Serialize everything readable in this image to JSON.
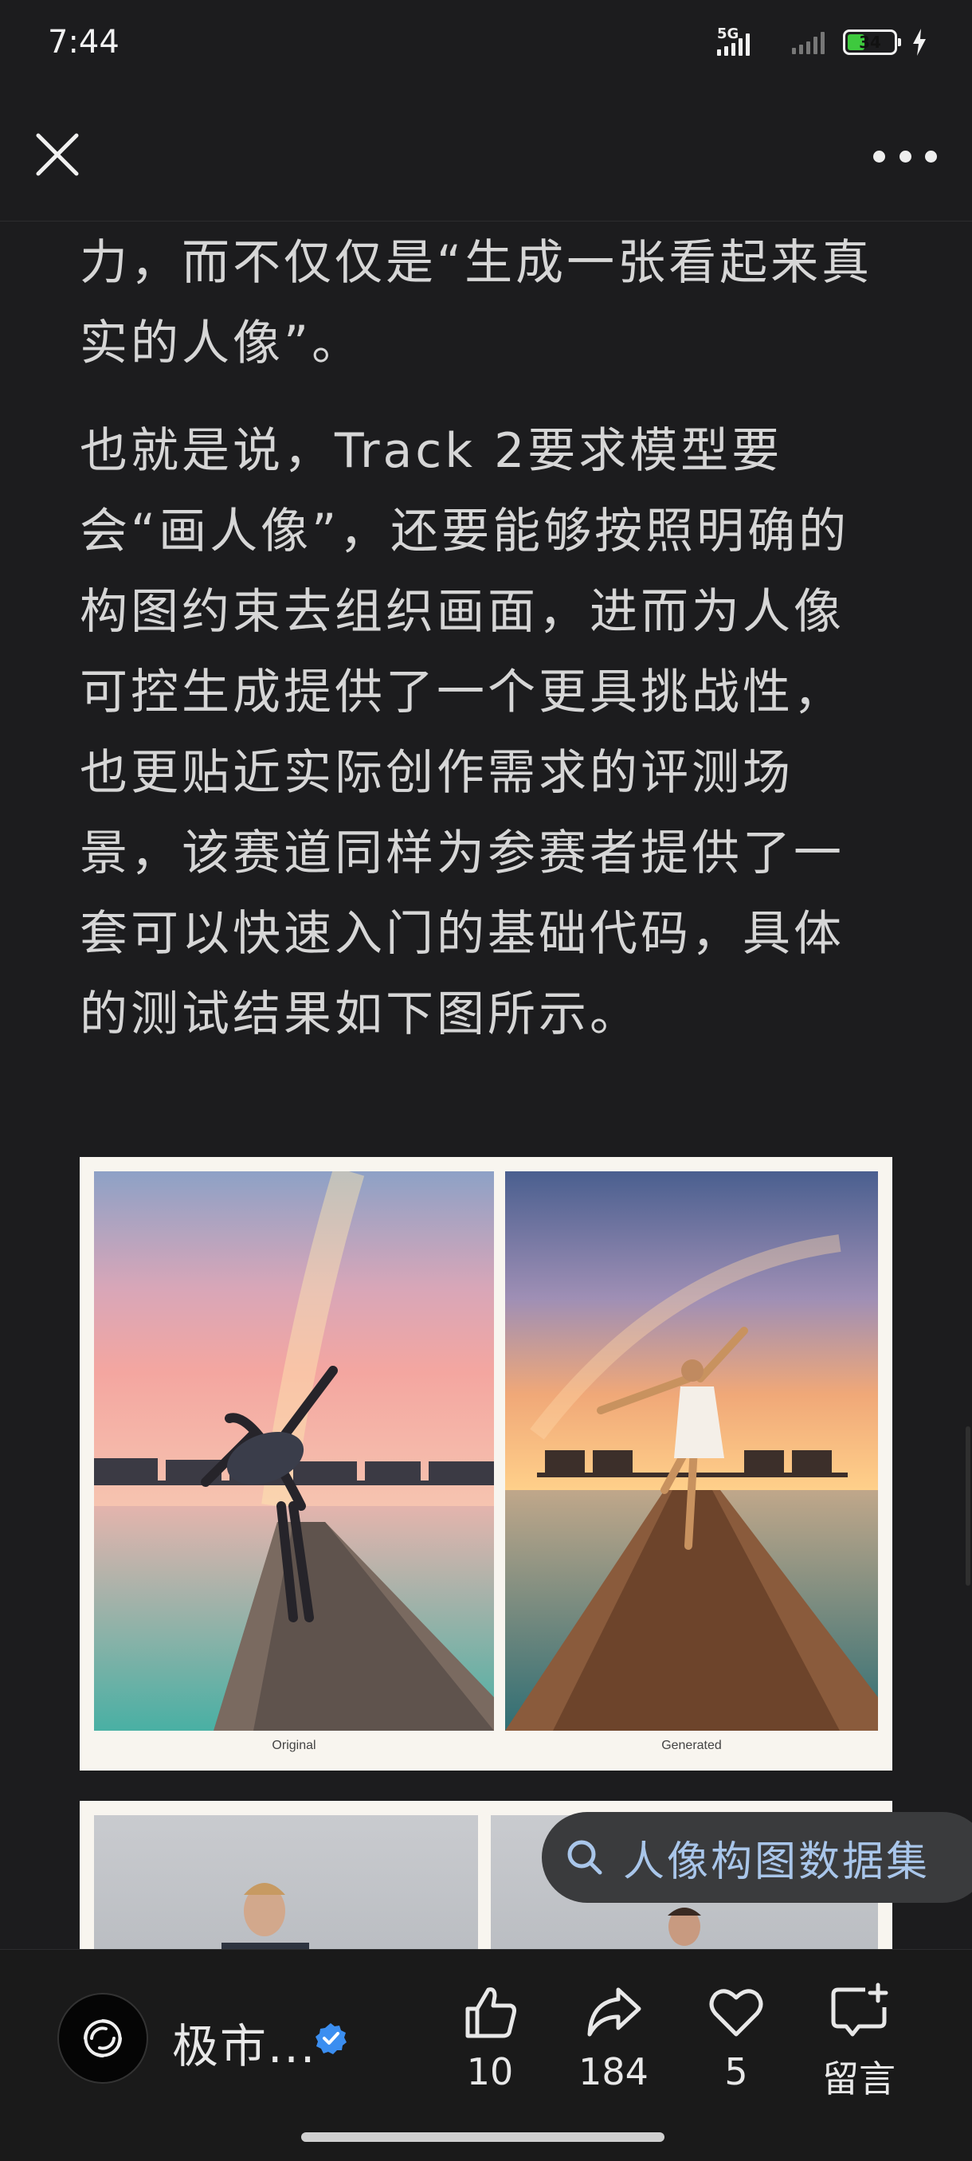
{
  "status_bar": {
    "time": "7:44",
    "network": "5G",
    "battery": "34"
  },
  "article": {
    "para1": "力，而不仅仅是“生成一张看起来真实的人像”。",
    "para2": "也就是说，Track 2要求模型要会“画人像”，还要能够按照明确的构图约束去组织画面，进而为人像可控生成提供了一个更具挑战性，也更贴近实际创作需求的评测场景，该赛道同样为参赛者提供了一套可以快速入门的基础代码，具体的测试结果如下图所示。"
  },
  "figure": {
    "caption_left": "Original",
    "caption_right": "Generated"
  },
  "search_chip": {
    "label": "人像构图数据集",
    "icon": "search-icon"
  },
  "bottom_bar": {
    "author_name": "极市...",
    "like_count": "10",
    "share_count": "184",
    "favorite_count": "5",
    "comment_label": "留言"
  },
  "colors": {
    "background": "#1c1c1e",
    "text": "#d6d6d6",
    "verified_blue": "#3b8ef0",
    "search_text": "#a9c6ea",
    "battery_green": "#3ec93e"
  }
}
